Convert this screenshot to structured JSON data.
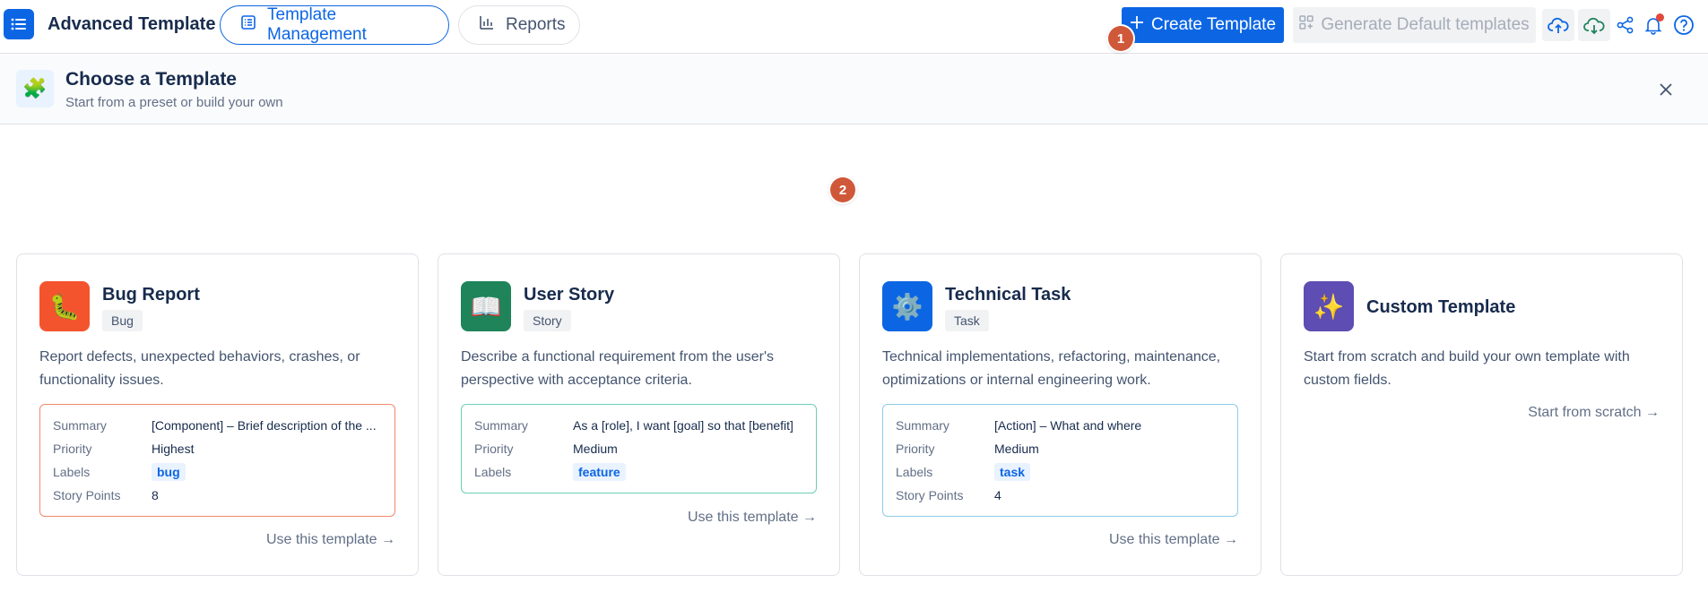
{
  "app": {
    "title": "Advanced Template"
  },
  "nav": {
    "tabs": [
      {
        "label": "Template Management",
        "icon": "list-icon",
        "active": true
      },
      {
        "label": "Reports",
        "icon": "bar-chart-icon",
        "active": false
      }
    ]
  },
  "toolbar": {
    "create_label": "Create Template",
    "generate_label": "Generate Default templates",
    "icons": [
      "upload-cloud-icon",
      "download-cloud-icon",
      "share-icon",
      "bell-icon",
      "help-icon"
    ]
  },
  "badges": {
    "step1": "1",
    "step2": "2"
  },
  "chooser": {
    "title": "Choose a Template",
    "subtitle": "Start from a preset or build your own"
  },
  "cards": [
    {
      "title": "Bug Report",
      "tag": "Bug",
      "icon": "caterpillar-icon",
      "icon_bg": "#f4542d",
      "description": "Report defects, unexpected behaviors, crashes, or functionality issues.",
      "border_color": "#f08a6b",
      "fields": {
        "summary_label": "Summary",
        "summary": "[Component] – Brief description of the ...",
        "priority_label": "Priority",
        "priority": "Highest",
        "labels_label": "Labels",
        "labels": "bug",
        "points_label": "Story Points",
        "points": "8"
      },
      "link": "Use this template →"
    },
    {
      "title": "User Story",
      "tag": "Story",
      "icon": "book-icon",
      "icon_bg": "#1f845a",
      "description": "Describe a functional requirement from the user's perspective with acceptance criteria.",
      "border_color": "#6ccfb7",
      "fields": {
        "summary_label": "Summary",
        "summary": "As a [role], I want [goal] so that [benefit]",
        "priority_label": "Priority",
        "priority": "Medium",
        "labels_label": "Labels",
        "labels": "feature"
      },
      "link": "Use this template →"
    },
    {
      "title": "Technical Task",
      "tag": "Task",
      "icon": "gear-icon",
      "icon_bg": "#0c66e4",
      "description": "Technical implementations, refactoring, maintenance, optimizations or internal engineering work.",
      "border_color": "#8fcbe9",
      "fields": {
        "summary_label": "Summary",
        "summary": "[Action] – What and where",
        "priority_label": "Priority",
        "priority": "Medium",
        "labels_label": "Labels",
        "labels": "task",
        "points_label": "Story Points",
        "points": "4"
      },
      "link": "Use this template →"
    },
    {
      "title": "Custom Template",
      "icon": "sparkles-icon",
      "icon_bg": "#5e4db2",
      "description": "Start from scratch and build your own template with custom fields.",
      "link": "Start from scratch →"
    }
  ]
}
